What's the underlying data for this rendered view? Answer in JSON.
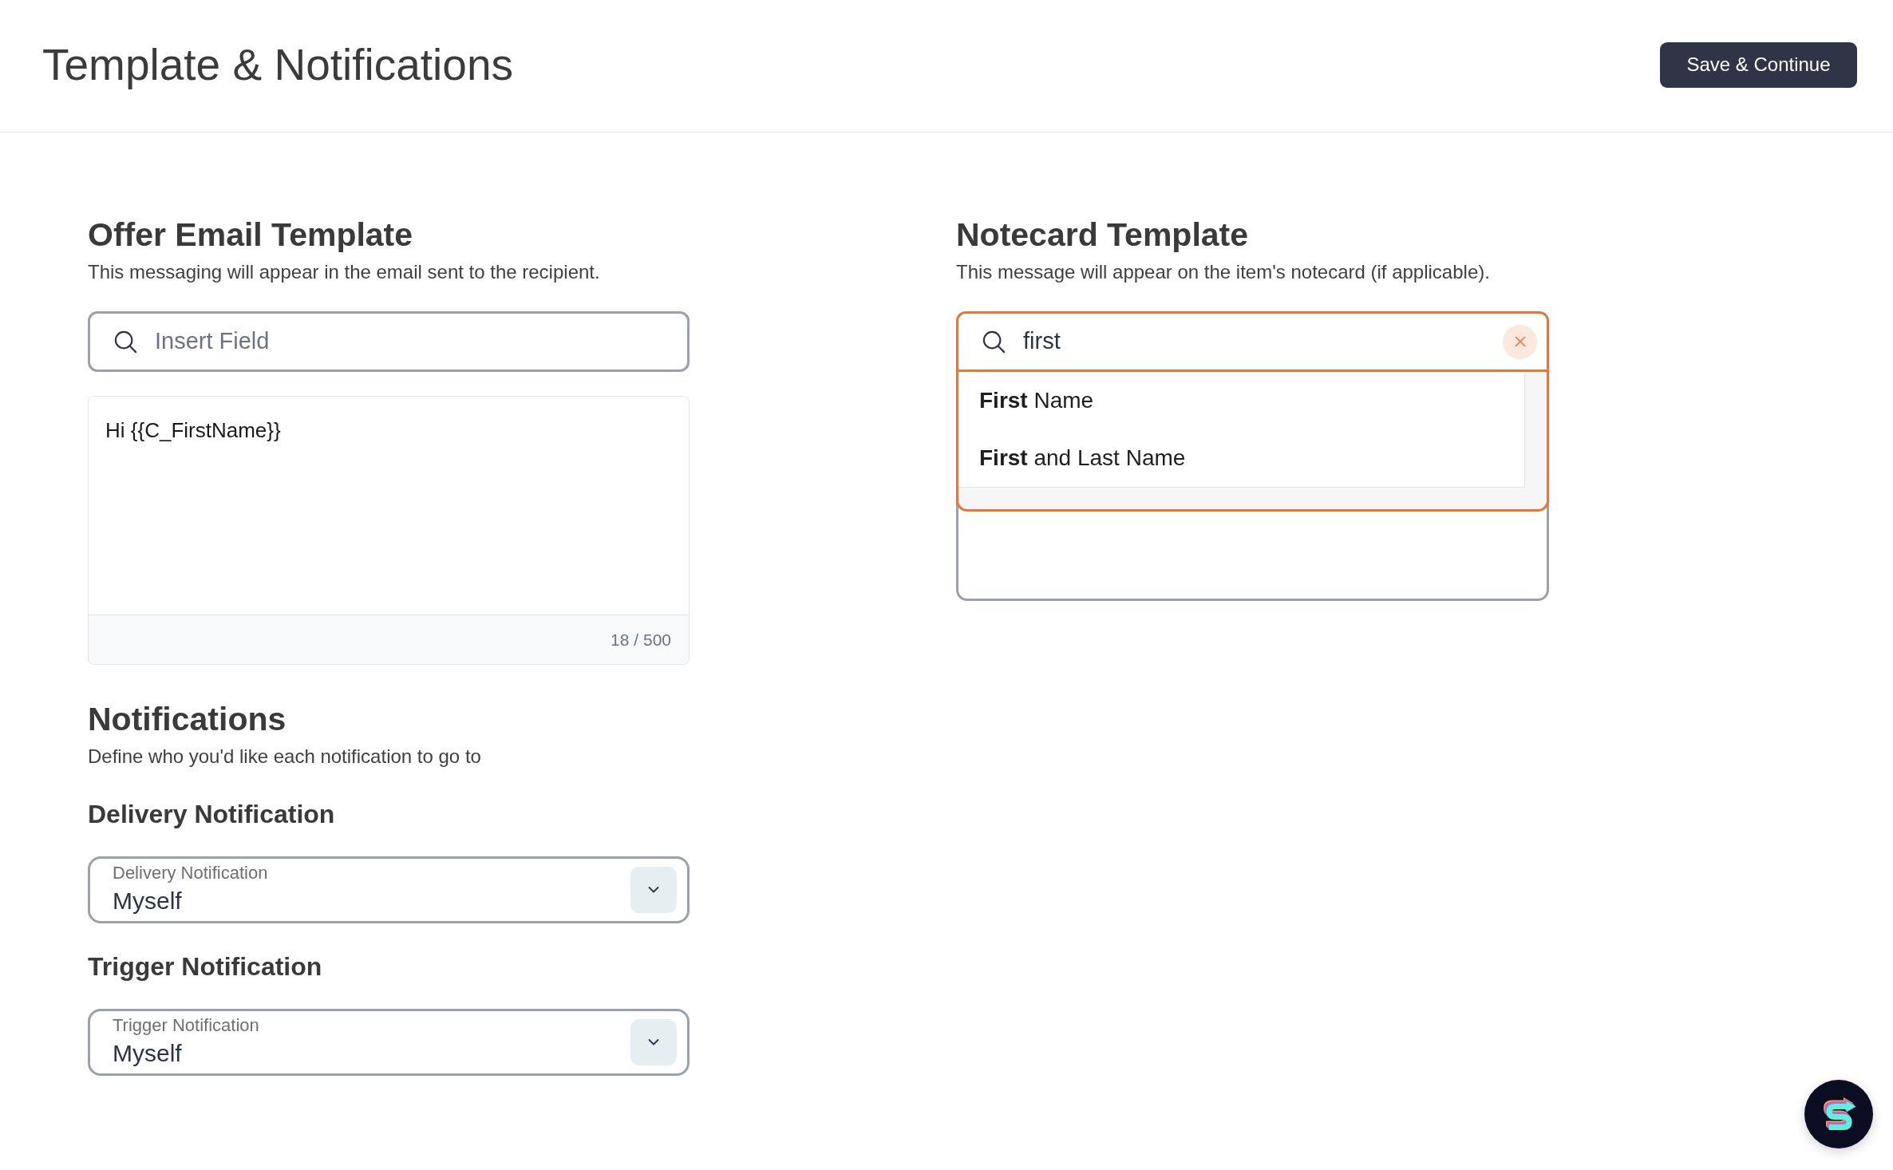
{
  "header": {
    "title": "Template & Notifications",
    "save_button": "Save & Continue"
  },
  "offer_email_template": {
    "title": "Offer Email Template",
    "description": "This messaging will appear in the email sent to the recipient.",
    "insert_field": {
      "placeholder": "Insert Field",
      "expanded": false
    },
    "message": {
      "value": "Hi {{C_FirstName}}",
      "counter": "18 / 500"
    }
  },
  "notecard_template": {
    "title": "Notecard Template",
    "description": "This message will appear on the item's notecard (if applicable).",
    "insert_field": {
      "value": "first",
      "expanded": true,
      "results": [
        "**First** Name",
        "**First** and Last Name"
      ]
    }
  },
  "notifications": {
    "title": "Notifications",
    "description": "Define who you'd like each notification to go to",
    "items": [
      {
        "heading": "Delivery Notification",
        "label": "Delivery Notification",
        "value": "Myself"
      },
      {
        "heading": "Trigger Notification",
        "label": "Trigger Notification",
        "value": "Myself"
      }
    ]
  }
}
